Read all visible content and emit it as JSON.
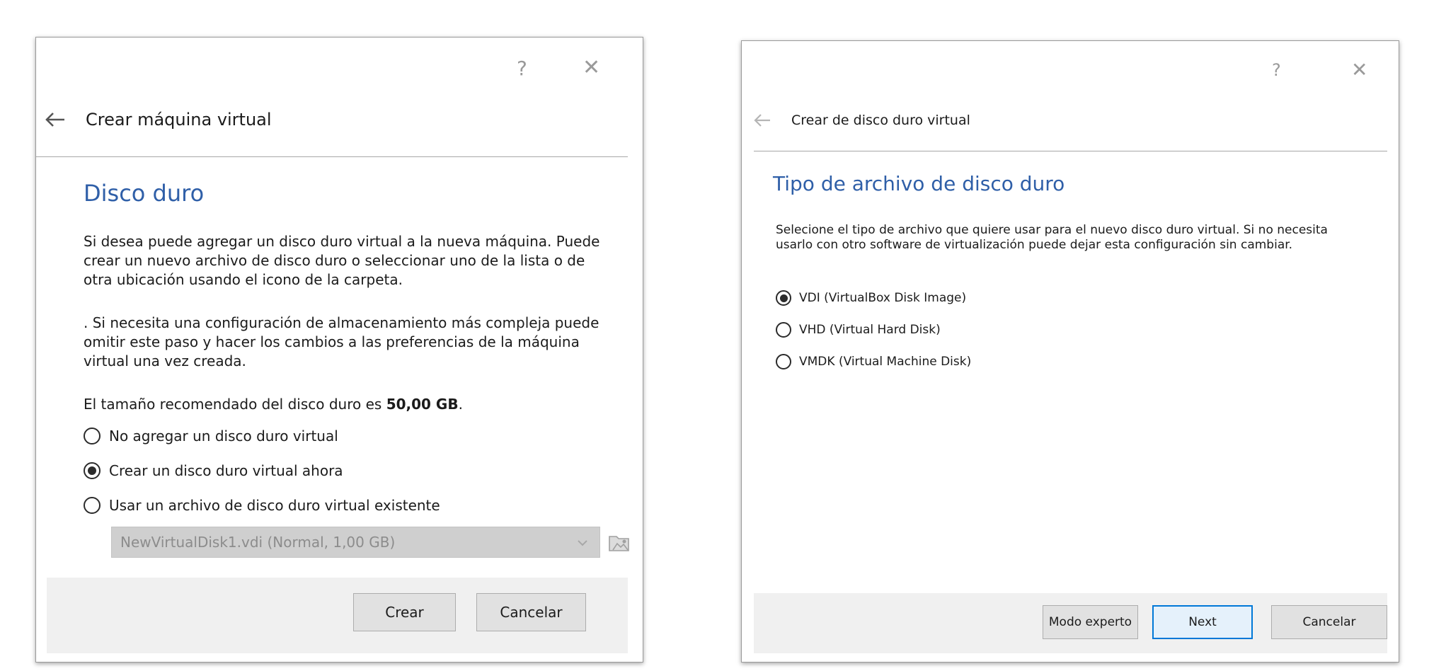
{
  "left_dialog": {
    "help_label": "?",
    "close_label": "✕",
    "back_icon": "arrow-left-icon",
    "header_title": "Crear máquina virtual",
    "section_title": "Disco duro",
    "paragraph1": "Si desea puede agregar un disco duro virtual a la nueva máquina. Puede crear un nuevo archivo de disco duro o seleccionar uno de la lista o de otra ubicación usando el icono de la carpeta.",
    "paragraph2": ". Si necesita una configuración de almacenamiento más compleja puede omitir este paso y hacer los cambios a las preferencias de la máquina virtual una vez creada.",
    "recommended_prefix": "El tamaño recomendado del disco duro es ",
    "recommended_size": "50,00 GB",
    "recommended_suffix": ".",
    "options": [
      {
        "label": "No agregar un disco duro virtual",
        "selected": false
      },
      {
        "label": "Crear un disco duro virtual ahora",
        "selected": true
      },
      {
        "label": "Usar un archivo de disco duro virtual existente",
        "selected": false
      }
    ],
    "combo_value": "NewVirtualDisk1.vdi (Normal, 1,00 GB)",
    "combo_icon": "chevron-down-icon",
    "folder_icon": "folder-icon",
    "create_button": "Crear",
    "cancel_button": "Cancelar"
  },
  "right_dialog": {
    "help_label": "?",
    "close_label": "✕",
    "back_icon": "arrow-left-icon",
    "header_title": "Crear de disco duro virtual",
    "section_title": "Tipo de archivo de disco duro",
    "paragraph": "Selecione el tipo de archivo que quiere usar para el nuevo disco duro virtual. Si no necesita usarlo con otro software de virtualización puede dejar esta configuración sin cambiar.",
    "options": [
      {
        "label": "VDI (VirtualBox Disk Image)",
        "selected": true
      },
      {
        "label": "VHD (Virtual Hard Disk)",
        "selected": false
      },
      {
        "label": "VMDK (Virtual Machine Disk)",
        "selected": false
      }
    ],
    "expert_button": "Modo experto",
    "next_button": "Next",
    "cancel_button": "Cancelar"
  },
  "colors": {
    "title_blue": "#2f5fa8",
    "focus_blue": "#0078d7",
    "footer_gray": "#f0f0f0"
  }
}
